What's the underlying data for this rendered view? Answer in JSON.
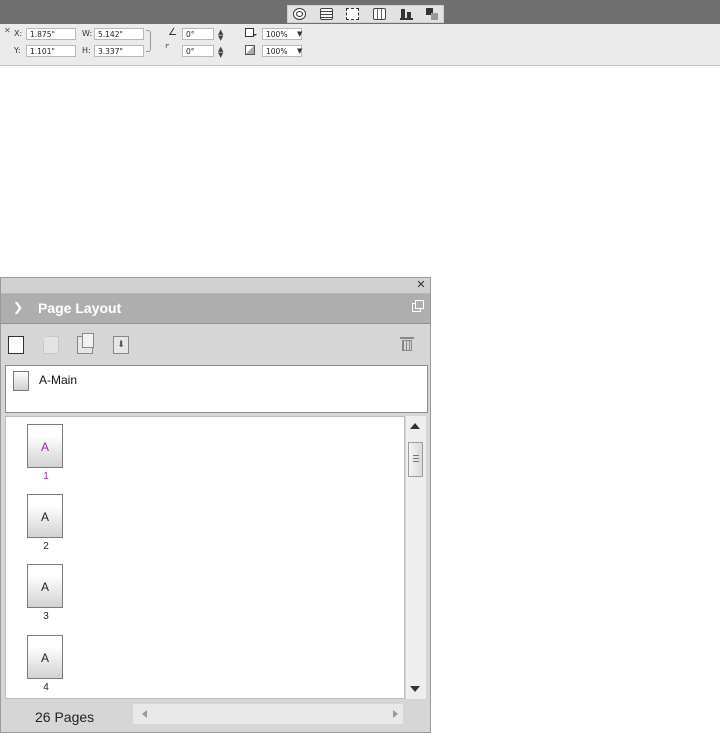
{
  "control_bar": {
    "x_label": "X:",
    "x_value": "1.875\"",
    "y_label": "Y:",
    "y_value": "1.101\"",
    "w_label": "W:",
    "w_value": "5.142\"",
    "h_label": "H:",
    "h_value": "3.337\"",
    "rotation_value": "0°",
    "shear_value": "0°",
    "stroke_scale": "100%",
    "opacity": "100%",
    "wrap_tools": [
      "wrap-none-icon",
      "wrap-around-box-icon",
      "wrap-around-bounds-icon",
      "wrap-object-shape-icon",
      "align-bottom-icon",
      "arrange-icon"
    ]
  },
  "page_layout": {
    "title": "Page Layout",
    "toolbar": [
      "blank-page-icon",
      "insert-page-icon",
      "duplicate-page-icon",
      "move-page-icon",
      "trash-icon"
    ],
    "master": {
      "label": "A-Main"
    },
    "pages": [
      {
        "letter": "A",
        "number": "1",
        "selected": true
      },
      {
        "letter": "A",
        "number": "2",
        "selected": false
      },
      {
        "letter": "A",
        "number": "3",
        "selected": false
      },
      {
        "letter": "A",
        "number": "4",
        "selected": false
      }
    ],
    "page_count": "26 Pages"
  },
  "colors": {
    "selected_page": "#a020a8",
    "panel_header": "#aeaeae",
    "toolbar_strip": "#6f6f6f"
  }
}
